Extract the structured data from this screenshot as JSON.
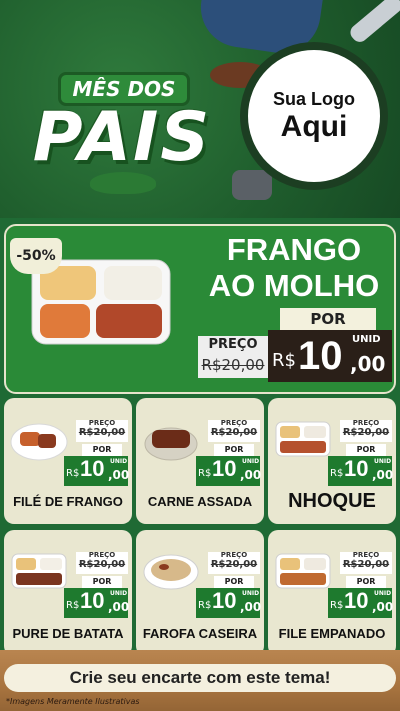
{
  "header": {
    "title_top": "MÊS DOS",
    "title_main": "PAIS",
    "logo_line1": "Sua Logo",
    "logo_line2": "Aqui"
  },
  "featured": {
    "discount": "-50%",
    "name_line1": "FRANGO",
    "name_line2": "AO MOLHO",
    "preco_label": "PREÇO",
    "old_price": "R$20,00",
    "por_label": "POR",
    "currency": "R$",
    "price_int": "10",
    "price_dec": ",00",
    "unit": "UNID"
  },
  "cards": [
    {
      "name": "FILÉ DE FRANGO",
      "preco_label": "PREÇO",
      "old_price": "R$20,00",
      "por_label": "POR",
      "currency": "R$",
      "price_int": "10",
      "price_dec": ",00",
      "unit": "UNID",
      "icon": "dish-steak-icon"
    },
    {
      "name": "CARNE ASSADA",
      "preco_label": "PREÇO",
      "old_price": "R$20,00",
      "por_label": "POR",
      "currency": "R$",
      "price_int": "10",
      "price_dec": ",00",
      "unit": "UNID",
      "icon": "dish-roast-icon"
    },
    {
      "name": "NHOQUE",
      "preco_label": "PREÇO",
      "old_price": "R$20,00",
      "por_label": "POR",
      "currency": "R$",
      "price_int": "10",
      "price_dec": ",00",
      "unit": "UNID",
      "icon": "dish-box-icon"
    },
    {
      "name": "PURE DE BATATA",
      "preco_label": "PREÇO",
      "old_price": "R$20,00",
      "por_label": "POR",
      "currency": "R$",
      "price_int": "10",
      "price_dec": ",00",
      "unit": "UNID",
      "icon": "dish-box-icon"
    },
    {
      "name": "FAROFA CASEIRA",
      "preco_label": "PREÇO",
      "old_price": "R$20,00",
      "por_label": "POR",
      "currency": "R$",
      "price_int": "10",
      "price_dec": ",00",
      "unit": "UNID",
      "icon": "dish-bowl-icon"
    },
    {
      "name": "FILE EMPANADO",
      "preco_label": "PREÇO",
      "old_price": "R$20,00",
      "por_label": "POR",
      "currency": "R$",
      "price_int": "10",
      "price_dec": ",00",
      "unit": "UNID",
      "icon": "dish-box-icon"
    }
  ],
  "footer": {
    "cta": "Crie seu encarte com este tema!",
    "disclaimer": "*Imagens Meramente Ilustrativas"
  },
  "colors": {
    "primary_green": "#2a8a37",
    "dark_green": "#1f6a34",
    "cream": "#e9e7d0",
    "price_green": "#1e7a2e"
  }
}
